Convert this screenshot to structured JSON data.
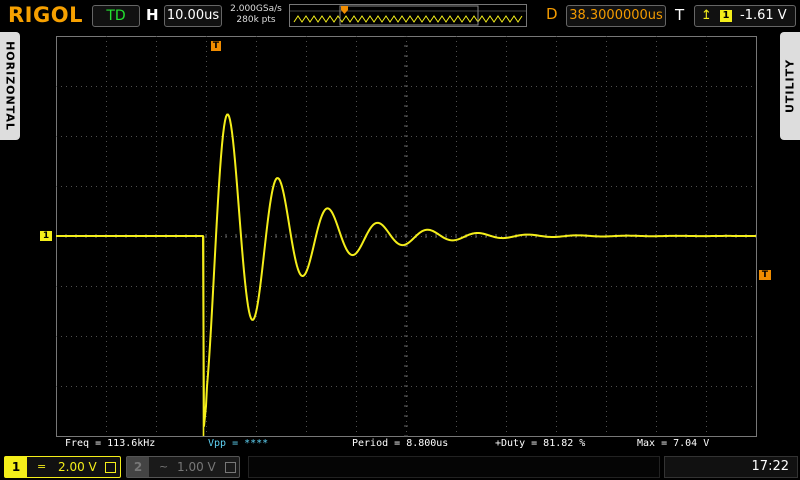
{
  "brand": "RIGOL",
  "header": {
    "run_status": "TD",
    "h_label": "H",
    "timebase": "10.00us",
    "sample_rate": "2.000GSa/s",
    "memory_depth": "280k pts",
    "delay_label": "D",
    "delay": "38.3000000us",
    "trigger_label": "T",
    "trigger_edge_icon": "rising-edge-icon",
    "trigger_source": "1",
    "trigger_level": "-1.61 V"
  },
  "tabs": {
    "horizontal": "HORIZONTAL",
    "utility": "UTILITY"
  },
  "markers": {
    "ch1": "1",
    "trigger_position": "T",
    "trigger_level": "T"
  },
  "measurements": [
    {
      "label": "Freq = ",
      "value": "113.6kHz"
    },
    {
      "label": "Vpp = ",
      "value": "****"
    },
    {
      "label": "Period = ",
      "value": "8.800us"
    },
    {
      "label": "+Duty = ",
      "value": "81.82 %"
    },
    {
      "label": "Max = ",
      "value": "7.04 V"
    }
  ],
  "channels": [
    {
      "number": "1",
      "coupling": "=",
      "scale": "2.00 V",
      "active": true
    },
    {
      "number": "2",
      "coupling": "~",
      "scale": "1.00 V",
      "active": false
    }
  ],
  "clock": "17:22",
  "colors": {
    "ch1": "#f4ee1a",
    "trigger": "#f08c00",
    "run_status": "#22e02f",
    "logo": "#f6a000"
  },
  "waveform": {
    "trigger_time_div": 2.95,
    "flat_level_div": 0,
    "edge_min_div": -3.9,
    "ringing": {
      "amplitude_div": 3.5,
      "period_div": 1.0,
      "decay_div": 1.35
    }
  }
}
